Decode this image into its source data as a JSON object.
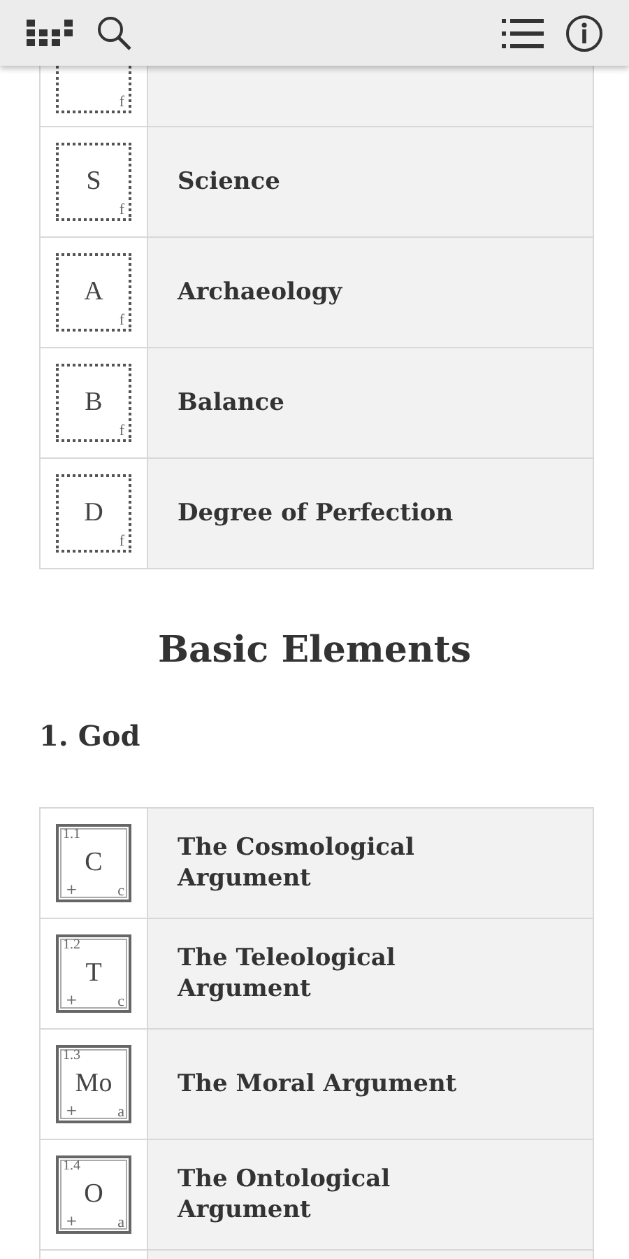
{
  "categories": [
    {
      "kind": "dashed",
      "corner": "f"
    },
    {
      "kind": "dashed",
      "symbol": "S",
      "corner": "f",
      "label": "Science"
    },
    {
      "kind": "dashed",
      "symbol": "A",
      "corner": "f",
      "label": "Archaeology"
    },
    {
      "kind": "dashed",
      "symbol": "B",
      "corner": "f",
      "label": "Balance"
    },
    {
      "kind": "dashed",
      "symbol": "D",
      "corner": "f",
      "label": "Degree of Perfection"
    }
  ],
  "section_title": "Basic Elements",
  "subsection_title": "1. God",
  "elements": [
    {
      "kind": "solid",
      "number": "1.1",
      "symbol": "C",
      "sign": "+",
      "corner": "c",
      "label": "The Cosmological Argument"
    },
    {
      "kind": "solid",
      "number": "1.2",
      "symbol": "T",
      "sign": "+",
      "corner": "c",
      "label": "The Teleological Argument"
    },
    {
      "kind": "solid",
      "number": "1.3",
      "symbol": "Mo",
      "sign": "+",
      "corner": "a",
      "label": "The Moral Argument"
    },
    {
      "kind": "solid",
      "number": "1.4",
      "symbol": "O",
      "sign": "+",
      "corner": "a",
      "label": "The Ontological Argument"
    }
  ]
}
